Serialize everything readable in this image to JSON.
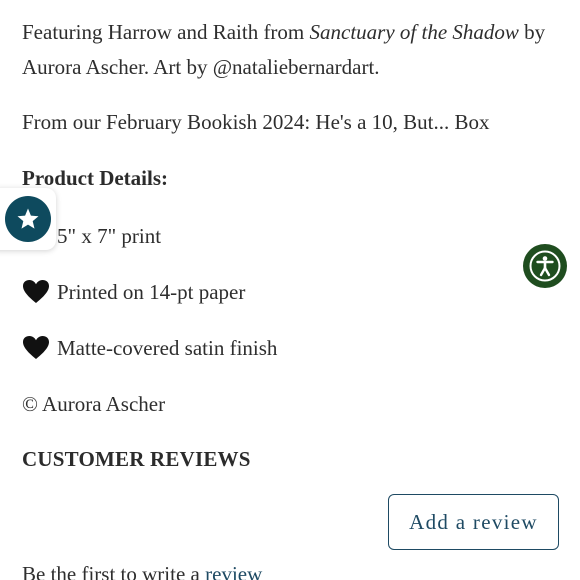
{
  "description": {
    "line1_prefix": "Featuring Harrow and Raith from ",
    "book_title": "Sanctuary of the Shadow",
    "line1_suffix": " by",
    "line2": "Aurora Ascher. Art by @nataliebernardart.",
    "box_line": "From our February Bookish 2024: He's a 10, But... Box"
  },
  "product_details": {
    "heading": "Product Details:",
    "items": [
      {
        "icon": "black-heart-icon",
        "text": "5\" x 7\" print"
      },
      {
        "icon": "black-heart-icon",
        "text": "Printed on 14-pt paper"
      },
      {
        "icon": "black-heart-icon",
        "text": "Matte-covered satin finish"
      }
    ],
    "copyright": "© Aurora Ascher"
  },
  "reviews": {
    "heading": "CUSTOMER REVIEWS",
    "add_review_label": "Add a review",
    "first_prefix": "Be the first to write a ",
    "first_link": "review"
  },
  "widgets": {
    "reviews_widget_icon": "star-icon",
    "accessibility_icon": "accessibility-icon"
  },
  "colors": {
    "accent": "#1e4a63",
    "reviews_widget": "#0e4a5e",
    "accessibility": "#1f4d1f"
  }
}
